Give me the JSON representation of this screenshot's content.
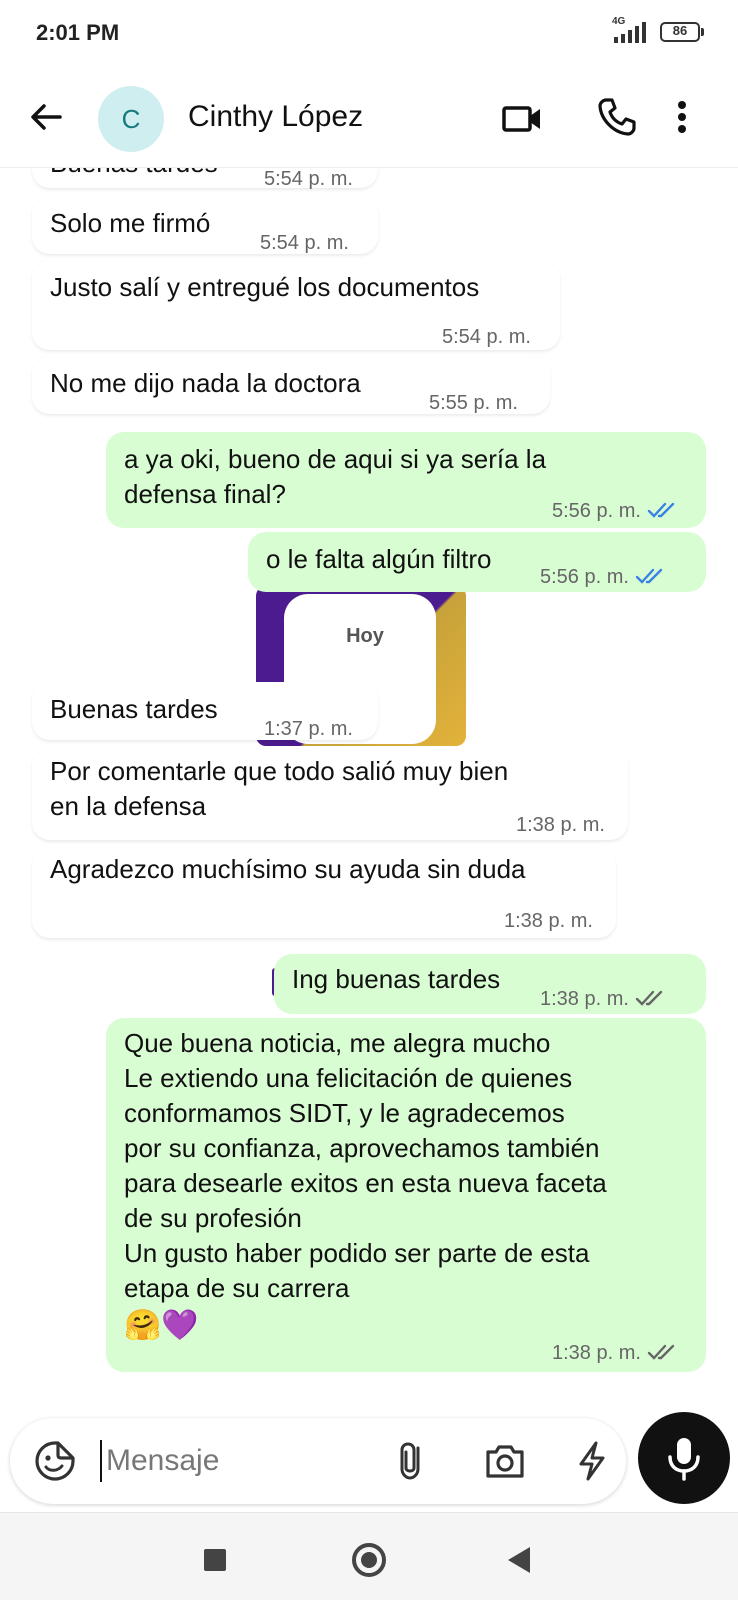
{
  "status_bar": {
    "time": "2:01 PM",
    "network": "4G",
    "battery": "86",
    "icons": [
      "signal-icon",
      "battery-icon"
    ]
  },
  "header": {
    "avatar_letter": "C",
    "contact_name": "Cinthy López",
    "icons": [
      "back-arrow-icon",
      "video-call-icon",
      "phone-icon",
      "more-vert-icon"
    ]
  },
  "chat": {
    "date_divider": "Hoy",
    "messages": [
      {
        "dir": "in",
        "text": "Buenas tardes",
        "time": "5:54 p. m."
      },
      {
        "dir": "in",
        "text": "Solo me firmó",
        "time": "5:54 p. m."
      },
      {
        "dir": "in",
        "text": "Justo salí y entregué los documentos",
        "time": "5:54 p. m."
      },
      {
        "dir": "in",
        "text": "No me dijo nada la doctora",
        "time": "5:55 p. m."
      },
      {
        "dir": "out",
        "text": "a ya oki, bueno de aqui si ya sería la\ndefensa final?",
        "time": "5:56 p. m.",
        "status": "read"
      },
      {
        "dir": "out",
        "text": "o le falta algún filtro",
        "time": "5:56 p. m.",
        "status": "read"
      },
      {
        "dir": "in",
        "text": "Buenas tardes",
        "time": "1:37 p. m."
      },
      {
        "dir": "in",
        "text": "Por comentarle que todo salió muy bien\nen la defensa",
        "time": "1:38 p. m."
      },
      {
        "dir": "in",
        "text": "Agradezco muchísimo su ayuda sin duda",
        "time": "1:38 p. m."
      },
      {
        "dir": "out",
        "text": "Ing buenas tardes",
        "time": "1:38 p. m.",
        "status": "delivered"
      },
      {
        "dir": "out",
        "text": "Que buena noticia, me alegra mucho\nLe extiendo una felicitación  de quienes\nconformamos SIDT, y le agradecemos\npor su confianza, aprovechamos también\npara desearle exitos en esta nueva faceta\nde su profesión\nUn gusto haber podido ser parte de esta\netapa de su carrera",
        "emoji": "🤗💜",
        "time": "1:38 p. m.",
        "status": "delivered"
      }
    ],
    "colors": {
      "incoming": "#ffffff",
      "outgoing": "#d9fdd3",
      "read_ticks": "#3a82e6",
      "delivered_ticks": "#666666"
    }
  },
  "composer": {
    "placeholder": "Mensaje",
    "icons": [
      "sticker-icon",
      "attach-icon",
      "camera-icon",
      "quick-action-icon",
      "mic-icon"
    ]
  },
  "nav": {
    "icons": [
      "recent-apps-icon",
      "home-icon",
      "back-icon"
    ]
  }
}
